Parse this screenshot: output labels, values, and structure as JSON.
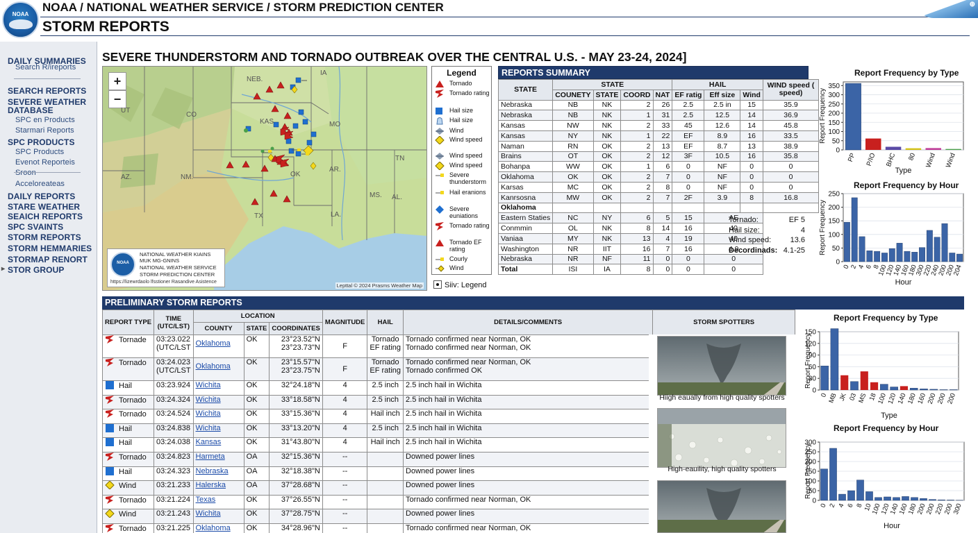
{
  "header": {
    "line1": "NOAA / NATIONAL WEATHER SERVICE / STORM PREDICTION CENTER",
    "line2": "STORM REPORTS",
    "logo_text": "NOAA"
  },
  "sidebar": {
    "items": [
      {
        "label": "DAILY SUMMARIES",
        "level": "top"
      },
      {
        "label": "Search R/ireports",
        "level": "sub"
      },
      {
        "label": "SEARCH REPORTS",
        "level": "top"
      },
      {
        "label": "SEVERE WEATHER",
        "level": "top"
      },
      {
        "label": "DATABASE",
        "level": "top"
      },
      {
        "label": "SPC en Products",
        "level": "sub"
      },
      {
        "label": "Starmari Reports",
        "level": "sub"
      },
      {
        "label": "SPC PRODUCTS",
        "level": "top"
      },
      {
        "label": "SPC Products",
        "level": "sub"
      },
      {
        "label": "Evenot Reporteis",
        "level": "sub"
      },
      {
        "label": "Sroon",
        "level": "sub"
      },
      {
        "label": "Acceloreateas",
        "level": "sub"
      },
      {
        "label": "DAILY REPORTS",
        "level": "top"
      },
      {
        "label": "STARE WEATHER",
        "level": "top"
      },
      {
        "label": "SEAICH REPORTS",
        "level": "top"
      },
      {
        "label": "SPC SVAINTS",
        "level": "top"
      },
      {
        "label": "STORM REPORTS",
        "level": "top"
      },
      {
        "label": "STORM HEMMARIES",
        "level": "top"
      },
      {
        "label": "STORMAP RENORT",
        "level": "top"
      },
      {
        "label": "STOR GROUP",
        "level": "top"
      }
    ]
  },
  "page_title": "SEVERE THUNDERSTORM AND TORNADO OUTBREAK OVER THE CENTRAL U.S. - MAY 23-24, 2024]",
  "map": {
    "zoom_in": "+",
    "zoom_out": "−",
    "state_labels": [
      "NEB.",
      "IA",
      "UT",
      "CO",
      "KAS",
      "MO",
      "AZ.",
      "NM.",
      "OK",
      "AR.",
      "TN",
      "TX",
      "LA.",
      "MS.",
      "AL."
    ],
    "note_logo": "NOAA",
    "note_lines": [
      "NATIONAL WEATHER KIAINS",
      "MUK MG-GNINS",
      "NATIONAL WEATHER SERVICE",
      "STORM PREDICTION CENTER"
    ],
    "note_url": "https://lizewrdaolo lfsstioner Rasandive Asistence",
    "credit": "Lepttal © 2024 Prasms Weather Map"
  },
  "legend": {
    "title": "Legend",
    "items": [
      {
        "icon": "tornado-triangle-icon",
        "label": "Tornado"
      },
      {
        "icon": "tornado-rating-icon",
        "label": "Tornado rating"
      },
      {
        "icon": "hail-square-icon",
        "label": "Hail size"
      },
      {
        "icon": "hail-cup-icon",
        "label": "Hail size"
      },
      {
        "icon": "wind-arrow-icon",
        "label": "Wind"
      },
      {
        "icon": "wind-diamond-icon",
        "label": "Wind speed"
      },
      {
        "icon": "wind-arrow-icon",
        "label": "Wind speed"
      },
      {
        "icon": "wind-diamond-icon",
        "label": "Wind speed"
      },
      {
        "icon": "wind-flag-icon",
        "label": "Severe thunderstorm"
      },
      {
        "icon": "wind-flag-icon",
        "label": "Hail eranions"
      },
      {
        "icon": "blue-diamond-icon",
        "label": "Severe euniations"
      },
      {
        "icon": "tornado-rating-icon",
        "label": "Tornado rating"
      },
      {
        "icon": "tornado-triangle-icon",
        "label": "Tornado EF rating"
      },
      {
        "icon": "wind-flag-icon",
        "label": "Courly"
      },
      {
        "icon": "wind-flag-diamond-icon",
        "label": "Wind"
      }
    ],
    "footer": "Siiv: Legend"
  },
  "summary": {
    "title": "REPORTS SUMMARY",
    "headers": {
      "state": "STATE",
      "state_group": "STATE",
      "hail_group": "HAIL",
      "wind_group": "WIND speed ( speed)",
      "cols": [
        "COUNETY",
        "STATE",
        "COORD",
        "NAT",
        "EF ratig",
        "Eff size",
        "Wind"
      ]
    },
    "rows": [
      [
        "Nebraska",
        "NB",
        "NK",
        "2",
        "26",
        "2.5",
        "2.5 in",
        "15",
        "35.9"
      ],
      [
        "Nebraska",
        "NB",
        "NK",
        "1",
        "31",
        "2.5",
        "12.5",
        "14",
        "36.9"
      ],
      [
        "Kansas",
        "NW",
        "NK",
        "2",
        "33",
        "45",
        "12.6",
        "14",
        "45.8"
      ],
      [
        "Kansas",
        "NY",
        "NK",
        "1",
        "22",
        "EF",
        "8.9",
        "16",
        "33.5"
      ],
      [
        "Naman",
        "RN",
        "OK",
        "2",
        "13",
        "EF",
        "8.7",
        "13",
        "38.9"
      ],
      [
        "Brains",
        "OT",
        "OK",
        "2",
        "12",
        "3F",
        "10.5",
        "16",
        "35.8"
      ],
      [
        "Bohanpa",
        "WW",
        "OK",
        "1",
        "6",
        "0",
        "NF",
        "0",
        "0"
      ],
      [
        "Oklahoma",
        "OK",
        "OK",
        "2",
        "7",
        "0",
        "NF",
        "0",
        "0"
      ],
      [
        "Karsas",
        "MC",
        "OK",
        "2",
        "8",
        "0",
        "NF",
        "0",
        "0"
      ],
      [
        "Kanrsosna",
        "MW",
        "OK",
        "2",
        "7",
        "2F",
        "3.9",
        "8",
        "16.8"
      ]
    ],
    "group_row": "Oklahoma",
    "rows2": [
      [
        "Eastern Staties",
        "NC",
        "NY",
        "6",
        "5",
        "15",
        "AE"
      ],
      [
        "Conmmin",
        "OL",
        "NK",
        "8",
        "14",
        "16",
        "40"
      ],
      [
        "Vaniaa",
        "MY",
        "NK",
        "13",
        "4",
        "19",
        "40"
      ],
      [
        "Washington",
        "NR",
        "IIT",
        "16",
        "7",
        "16",
        "4.9"
      ],
      [
        "Nebraska",
        "NR",
        "NF",
        "11",
        "0",
        "0",
        "0"
      ]
    ],
    "total": [
      "Total",
      "ISI",
      "IA",
      "8",
      "0",
      "0",
      "0"
    ],
    "side": [
      {
        "k": "Tornado:",
        "v": "EF 5"
      },
      {
        "k": "Hail size:",
        "v": "4"
      },
      {
        "k": "Wind speed:",
        "v": "13.6"
      },
      {
        "k": "Decordinads:",
        "v": "4.1-25"
      }
    ]
  },
  "prelim": {
    "title": "PRELIMINARY STORM REPORTS",
    "headers": {
      "type": "REPORT TYPE",
      "time": "TIME (UTC/LST)",
      "location": "LOCATION",
      "county": "COUNTY",
      "state": "STATE",
      "coords": "COORDINATES",
      "magnitude": "MAGNITUDE",
      "hail": "HAIL",
      "details": "DETAILS/COMMENTS",
      "spotters": "STORM SPOTTERS"
    },
    "rows": [
      {
        "icon": "tornado",
        "type": "Tornade",
        "time": "03:23.022",
        "time2": "(UTC/LST",
        "county": "Oklahoma",
        "state": "OK",
        "c1": "23°23.52\"N",
        "c2": "23°23.73\"N",
        "mag": "F",
        "hail": "Tornado",
        "hail2": "EF rating",
        "d1": "Tornado confirmed near Norman, OK",
        "d2": "Tornado confirmed near Norman, OK"
      },
      {
        "icon": "tornado",
        "type": "Tornado",
        "time": "03:24.023",
        "time2": "(UTC/LST",
        "county": "Oklahoma",
        "state": "OK",
        "c1": "23°15.57\"N",
        "c2": "23°23.75\"N",
        "mag": "F",
        "hail": "Tornado",
        "hail2": "EF rating",
        "d1": "Tornado confirmed near Norman, OK",
        "d2": "Tornado confirmed OK"
      },
      {
        "icon": "hail",
        "type": "Hail",
        "time": "03:23.924",
        "county": "Wichita",
        "state": "OK",
        "c1": "32°24.18\"N",
        "mag": "4",
        "hail": "2.5 inch",
        "d1": "2.5 inch hail in Wichita"
      },
      {
        "icon": "tornado",
        "type": "Tornado",
        "time": "03:24.324",
        "county": "Wichita",
        "state": "OK",
        "c1": "33°18.58\"N",
        "mag": "4",
        "hail": "2.5 inch",
        "d1": "2.5 inch hail in Wichita"
      },
      {
        "icon": "tornado",
        "type": "Tornado",
        "time": "03:24.524",
        "county": "Wichita",
        "state": "OK",
        "c1": "33°15.36\"N",
        "mag": "4",
        "hail": "Hail inch",
        "d1": "2.5 inch hail in Wichita"
      },
      {
        "icon": "hail",
        "type": "Hail",
        "time": "03:24.838",
        "county": "Wichita",
        "state": "OK",
        "c1": "33°13.20\"N",
        "mag": "4",
        "hail": "2.5 inch",
        "d1": "2.5 inch hail in Wichita"
      },
      {
        "icon": "hail",
        "type": "Hail",
        "time": "03:24.038",
        "county": "Kansas",
        "state": "OK",
        "c1": "31°43.80\"N",
        "mag": "4",
        "hail": "Hail inch",
        "d1": "2.5 inch hail in Wichita"
      },
      {
        "icon": "tornado",
        "type": "Tornado",
        "time": "03:24.823",
        "county": "Harmeta",
        "state": "OA",
        "c1": "32°15.36\"N",
        "mag": "--",
        "hail": "",
        "d1": "Downed power lines"
      },
      {
        "icon": "hail",
        "type": "Hail",
        "time": "03:24.323",
        "county": "Nebraska",
        "state": "OA",
        "c1": "32°18.38\"N",
        "mag": "--",
        "hail": "",
        "d1": "Downed power lines"
      },
      {
        "icon": "wind",
        "type": "Wind",
        "time": "03:21.233",
        "county": "Halerska",
        "state": "OA",
        "c1": "37°28.68\"N",
        "mag": "--",
        "hail": "",
        "d1": "Downed power lines"
      },
      {
        "icon": "tornado",
        "type": "Tornado",
        "time": "03:21.224",
        "county": "Texas",
        "state": "OK",
        "c1": "37°26.55\"N",
        "mag": "--",
        "hail": "",
        "d1": "Tornado confirmed near Norman, OK"
      },
      {
        "icon": "wind",
        "type": "Wind",
        "time": "03:21.243",
        "county": "Wichita",
        "state": "OK",
        "c1": "37°28.75\"N",
        "mag": "--",
        "hail": "",
        "d1": "Downed power lines"
      },
      {
        "icon": "tornado",
        "type": "Tornado",
        "time": "03:21.225",
        "county": "Oklahoma",
        "state": "OK",
        "c1": "34°28.96\"N",
        "mag": "--",
        "hail": "",
        "d1": "Tornado confirmed near Norman, OK"
      }
    ],
    "spotters": [
      {
        "caption": "Hiigh eaually from high quality spotters",
        "kind": "tornado-photo"
      },
      {
        "caption": "High-eauility, high quality spotters",
        "kind": "hail-photo"
      },
      {
        "caption": "",
        "kind": "tornado-photo"
      }
    ]
  },
  "colors": {
    "navy": "#1f3a6b",
    "bar_blue": "#3b64a6",
    "bar_red": "#c8201e",
    "bar_purple": "#7a4aa0",
    "bar_yellow": "#d4c21a",
    "bar_pink": "#c0409a",
    "bar_green": "#4aa04a"
  },
  "chart_data": [
    {
      "type": "bar",
      "title": "Report Frequency by Type",
      "xlabel": "Type",
      "ylabel": "Report Frequency",
      "categories": [
        "PP",
        "P/IO",
        "BHC",
        "80",
        "Wind",
        "Wind"
      ],
      "values": [
        362,
        62,
        17,
        9,
        10,
        5
      ],
      "bar_colors": [
        "#3b64a6",
        "#c8201e",
        "#5a4aa6",
        "#d4c21a",
        "#c0409a",
        "#4aa04a"
      ],
      "ylim": [
        0,
        370
      ],
      "yticks": [
        0,
        50,
        100,
        150,
        200,
        250,
        300,
        350
      ]
    },
    {
      "type": "bar",
      "title": "Report Frequency by Hour",
      "xlabel": "Hour",
      "ylabel": "Report Frequency",
      "categories": [
        "0",
        "2",
        "4",
        "6",
        "8",
        "100",
        "120",
        "140",
        "160",
        "180",
        "300",
        "220",
        "240",
        "200",
        "200",
        "204"
      ],
      "values": [
        145,
        235,
        92,
        40,
        38,
        32,
        48,
        68,
        38,
        35,
        52,
        115,
        90,
        140,
        32,
        28
      ],
      "ylim": [
        0,
        250
      ],
      "yticks": [
        0,
        50,
        100,
        150,
        200,
        250
      ]
    },
    {
      "type": "bar",
      "title": "Report Frequency by Type",
      "xlabel": "Type",
      "ylabel": "Report Frequency",
      "categories": [
        "0",
        "MB",
        "JK",
        "03",
        "MS",
        "18",
        "100",
        "120",
        "140",
        "180",
        "160",
        "200",
        "200",
        "200"
      ],
      "values": [
        62,
        158,
        38,
        22,
        48,
        20,
        15,
        8,
        10,
        5,
        3,
        2,
        1,
        1
      ],
      "bar_colors": [
        "#3b64a6",
        "#3b64a6",
        "#c8201e",
        "#3b64a6",
        "#c8201e",
        "#c8201e",
        "#3b64a6",
        "#3b64a6",
        "#c8201e",
        "#3b64a6",
        "#3b64a6",
        "#3b64a6",
        "#3b64a6",
        "#3b64a6"
      ],
      "ylim": [
        0,
        150
      ],
      "yticks": [
        0,
        30,
        60,
        90,
        120,
        150
      ]
    },
    {
      "type": "bar",
      "title": "Report Frequency by Hour",
      "xlabel": "Hour",
      "ylabel": "Report Frequency",
      "categories": [
        "0",
        "2",
        "4",
        "6",
        "8",
        "10",
        "100",
        "120",
        "140",
        "160",
        "180",
        "200",
        "200",
        "220",
        "200",
        "300"
      ],
      "values": [
        162,
        268,
        32,
        50,
        105,
        45,
        15,
        18,
        15,
        20,
        15,
        10,
        5,
        3,
        2,
        1
      ],
      "ylim": [
        0,
        300
      ],
      "yticks": [
        0,
        50,
        100,
        150,
        200,
        250,
        300
      ]
    }
  ]
}
